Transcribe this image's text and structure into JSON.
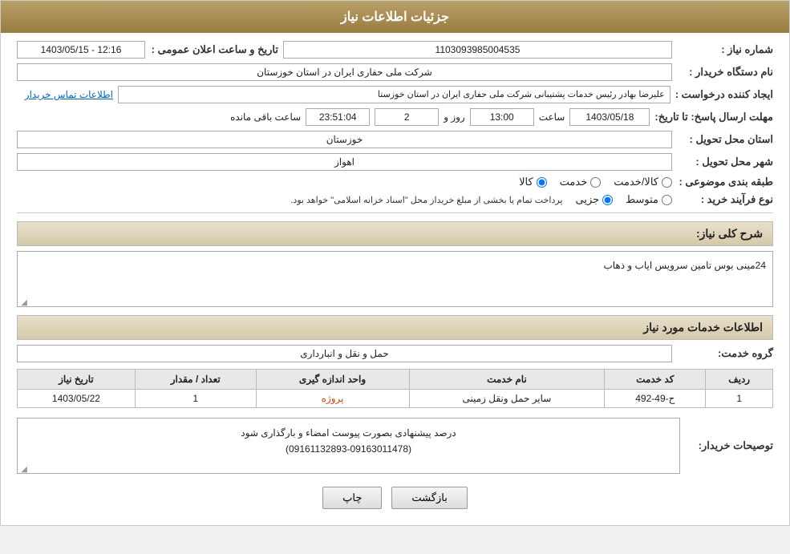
{
  "page": {
    "title": "جزئیات اطلاعات نیاز",
    "back_button": "بازگشت",
    "print_button": "چاپ"
  },
  "fields": {
    "need_number_label": "شماره نیاز :",
    "need_number_value": "1103093985004535",
    "buyer_org_label": "نام دستگاه خریدار :",
    "buyer_org_value": "شرکت ملی حفاری ایران در استان خوزستان",
    "announce_date_label": "تاریخ و ساعت اعلان عمومی :",
    "announce_date_value": "1403/05/15 - 12:16",
    "creator_label": "ایجاد کننده درخواست :",
    "creator_value": "علیرضا بهادر رئیس خدمات پشتیبانی شرکت ملی حفاری ایران در استان خوزستا",
    "contact_link": "اطلاعات تماس خریدار",
    "reply_deadline_label": "مهلت ارسال پاسخ: تا تاریخ:",
    "deadline_date": "1403/05/18",
    "deadline_time_label": "ساعت",
    "deadline_time": "13:00",
    "deadline_day_label": "روز و",
    "deadline_days": "2",
    "deadline_remaining_label": "ساعت باقی مانده",
    "deadline_remaining": "23:51:04",
    "delivery_province_label": "استان محل تحویل :",
    "delivery_province_value": "خوزستان",
    "delivery_city_label": "شهر محل تحویل :",
    "delivery_city_value": "اهواز",
    "category_label": "طبقه بندی موضوعی :",
    "category_options": [
      "کالا",
      "خدمت",
      "کالا/خدمت"
    ],
    "category_selected": "کالا",
    "purchase_type_label": "نوع فرآیند خرید :",
    "purchase_type_options": [
      "جزیی",
      "متوسط"
    ],
    "purchase_type_note": "پرداخت تمام یا بخشی از مبلغ خریداز محل \"اسناد خزانه اسلامی\" خواهد بود.",
    "need_description_label": "شرح کلی نیاز:",
    "need_description_value": "24مینی بوس تامین سرویس ایاب و ذهاب",
    "services_section_title": "اطلاعات خدمات مورد نیاز",
    "service_group_label": "گروه خدمت:",
    "service_group_value": "حمل و نقل و انبارداری",
    "table": {
      "columns": [
        "ردیف",
        "کد خدمت",
        "نام خدمت",
        "واحد اندازه گیری",
        "تعداد / مقدار",
        "تاریخ نیاز"
      ],
      "rows": [
        {
          "row": "1",
          "code": "ح-49-492",
          "name": "سایر حمل ونقل زمینی",
          "unit": "پروژه",
          "quantity": "1",
          "date": "1403/05/22"
        }
      ]
    },
    "buyer_notes_label": "توصیحات خریدار:",
    "buyer_notes_value": "درصد پیشنهادی بصورت پیوست امضاء و بارگذاری شود\n(09161132893-09163011478)"
  }
}
